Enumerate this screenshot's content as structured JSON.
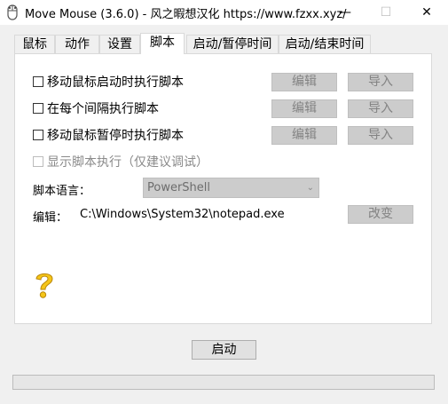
{
  "window": {
    "title": "Move Mouse (3.6.0) - 风之暇想汉化 https://www.fzxx.xyz/",
    "min": "—",
    "max": "☐",
    "close": "✕"
  },
  "tabs": [
    {
      "label": "鼠标"
    },
    {
      "label": "动作"
    },
    {
      "label": "设置"
    },
    {
      "label": "脚本"
    },
    {
      "label": "启动/暂停时间"
    },
    {
      "label": "启动/结束时间"
    }
  ],
  "script_rows": [
    {
      "label": "移动鼠标启动时执行脚本",
      "checked": false,
      "edit": "编辑",
      "import": "导入"
    },
    {
      "label": "在每个间隔执行脚本",
      "checked": false,
      "edit": "编辑",
      "import": "导入"
    },
    {
      "label": "移动鼠标暂停时执行脚本",
      "checked": false,
      "edit": "编辑",
      "import": "导入"
    }
  ],
  "show_script": {
    "label": "显示脚本执行（仅建议调试）",
    "checked": false,
    "disabled": true
  },
  "language": {
    "label": "脚本语言：",
    "value": "PowerShell"
  },
  "editor": {
    "label": "编辑：",
    "path": "C:\\Windows\\System32\\notepad.exe",
    "change": "改变"
  },
  "start_button": "启动",
  "colors": {
    "help_icon": "#f5c518"
  }
}
